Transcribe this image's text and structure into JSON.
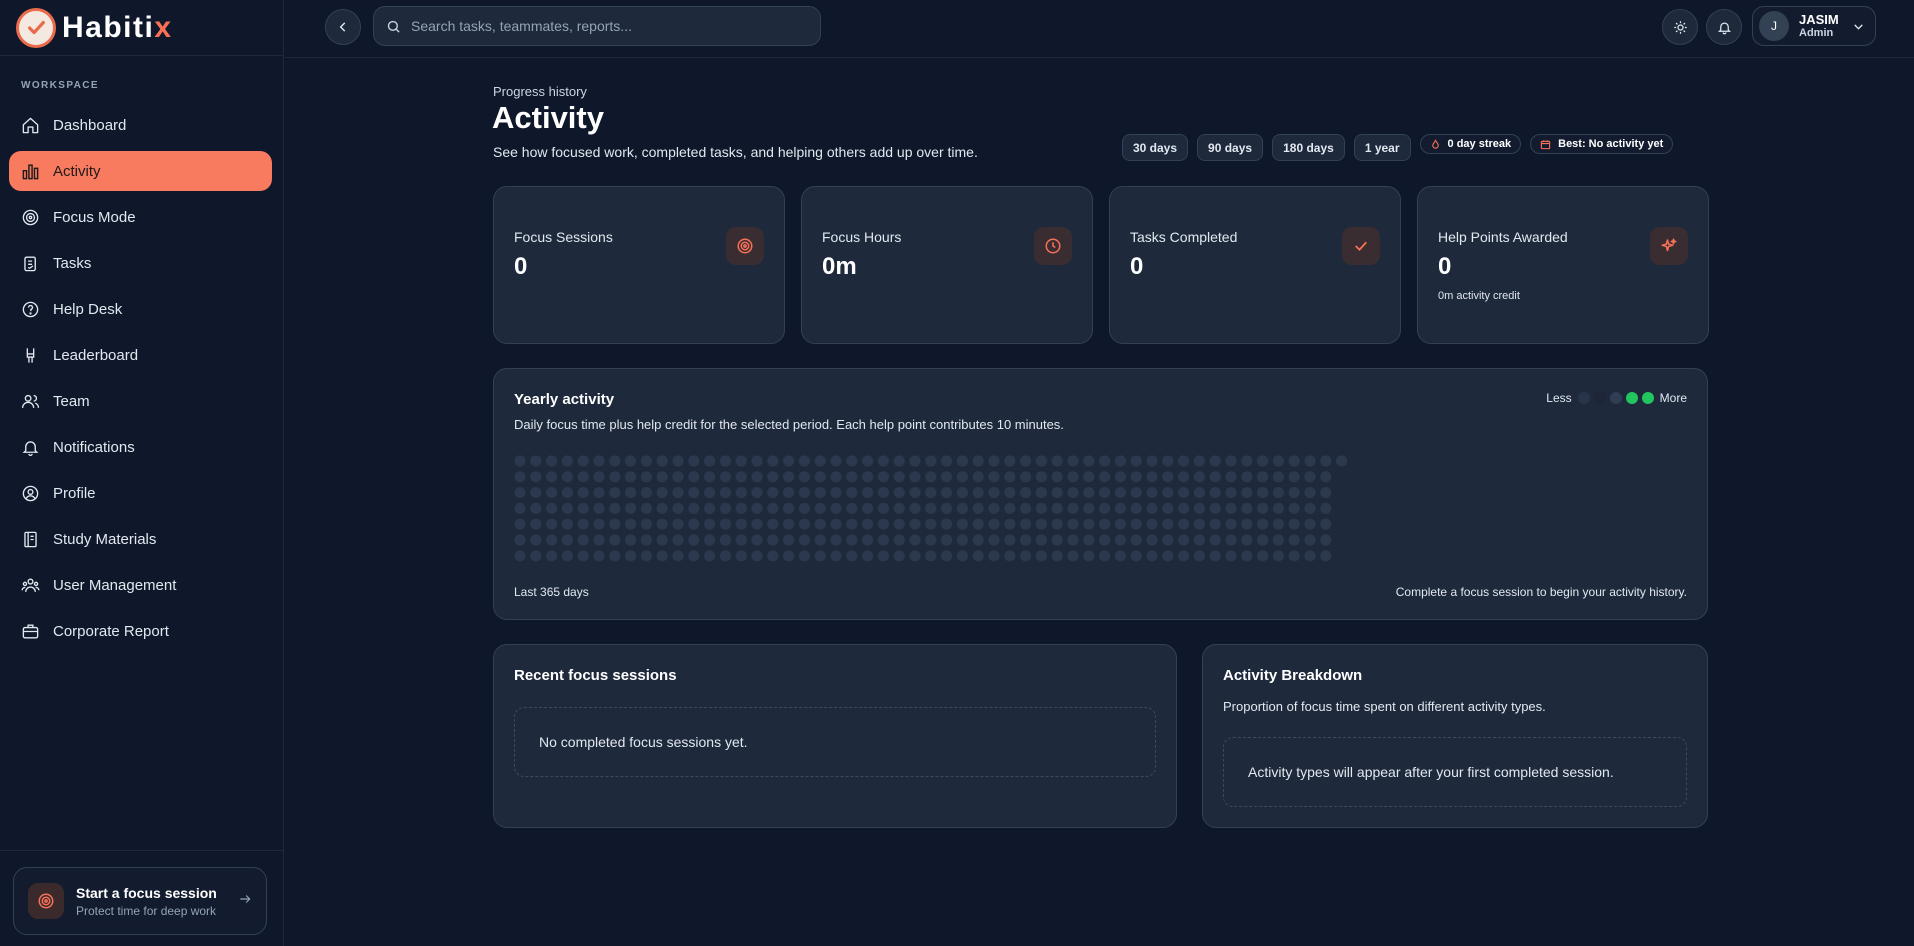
{
  "brand": {
    "name_main": "Habiti",
    "name_accent": "x"
  },
  "sidebar": {
    "section_label": "WORKSPACE",
    "items": [
      {
        "label": "Dashboard",
        "icon": "home-icon",
        "active": false
      },
      {
        "label": "Activity",
        "icon": "bar-chart-icon",
        "active": true
      },
      {
        "label": "Focus Mode",
        "icon": "target-icon",
        "active": false
      },
      {
        "label": "Tasks",
        "icon": "clipboard-icon",
        "active": false
      },
      {
        "label": "Help Desk",
        "icon": "help-circle-icon",
        "active": false
      },
      {
        "label": "Leaderboard",
        "icon": "award-icon",
        "active": false
      },
      {
        "label": "Team",
        "icon": "users-icon",
        "active": false
      },
      {
        "label": "Notifications",
        "icon": "bell-icon",
        "active": false
      },
      {
        "label": "Profile",
        "icon": "user-circle-icon",
        "active": false
      },
      {
        "label": "Study Materials",
        "icon": "book-icon",
        "active": false
      },
      {
        "label": "User Management",
        "icon": "user-cog-icon",
        "active": false
      },
      {
        "label": "Corporate Report",
        "icon": "briefcase-icon",
        "active": false
      }
    ],
    "focus_card": {
      "title": "Start a focus session",
      "subtitle": "Protect time for deep work"
    }
  },
  "topbar": {
    "search_placeholder": "Search tasks, teammates, reports...",
    "user": {
      "initial": "J",
      "name": "JASIM",
      "role": "Admin"
    }
  },
  "page": {
    "eyebrow": "Progress history",
    "title": "Activity",
    "subtitle": "See how focused work, completed tasks, and helping others add up over time.",
    "ranges": [
      "30 days",
      "90 days",
      "180 days",
      "1 year"
    ],
    "streak": "0 day streak",
    "best": "Best: No activity yet"
  },
  "stats": [
    {
      "label": "Focus Sessions",
      "value": "0",
      "note": "",
      "icon": "target-icon"
    },
    {
      "label": "Focus Hours",
      "value": "0m",
      "note": "",
      "icon": "clock-icon"
    },
    {
      "label": "Tasks Completed",
      "value": "0",
      "note": "",
      "icon": "check-icon"
    },
    {
      "label": "Help Points Awarded",
      "value": "0",
      "note": "0m activity credit",
      "icon": "sparkles-icon"
    }
  ],
  "yearly": {
    "title": "Yearly activity",
    "subtitle": "Daily focus time plus help credit for the selected period. Each help point contributes 10 minutes.",
    "legend_less": "Less",
    "legend_more": "More",
    "legend_colors": [
      "#27344a",
      "#1c2638",
      "#2f3d55",
      "#22c55e",
      "#22c55e"
    ],
    "footer_left": "Last 365 days",
    "footer_right": "Complete a focus session to begin your activity history."
  },
  "recent": {
    "title": "Recent focus sessions",
    "empty": "No completed focus sessions yet."
  },
  "breakdown": {
    "title": "Activity Breakdown",
    "subtitle": "Proportion of focus time spent on different activity types.",
    "empty": "Activity types will appear after your first completed session."
  },
  "colors": {
    "accent": "#f87a5f",
    "bg": "#0f172a",
    "card": "#1e293b"
  }
}
